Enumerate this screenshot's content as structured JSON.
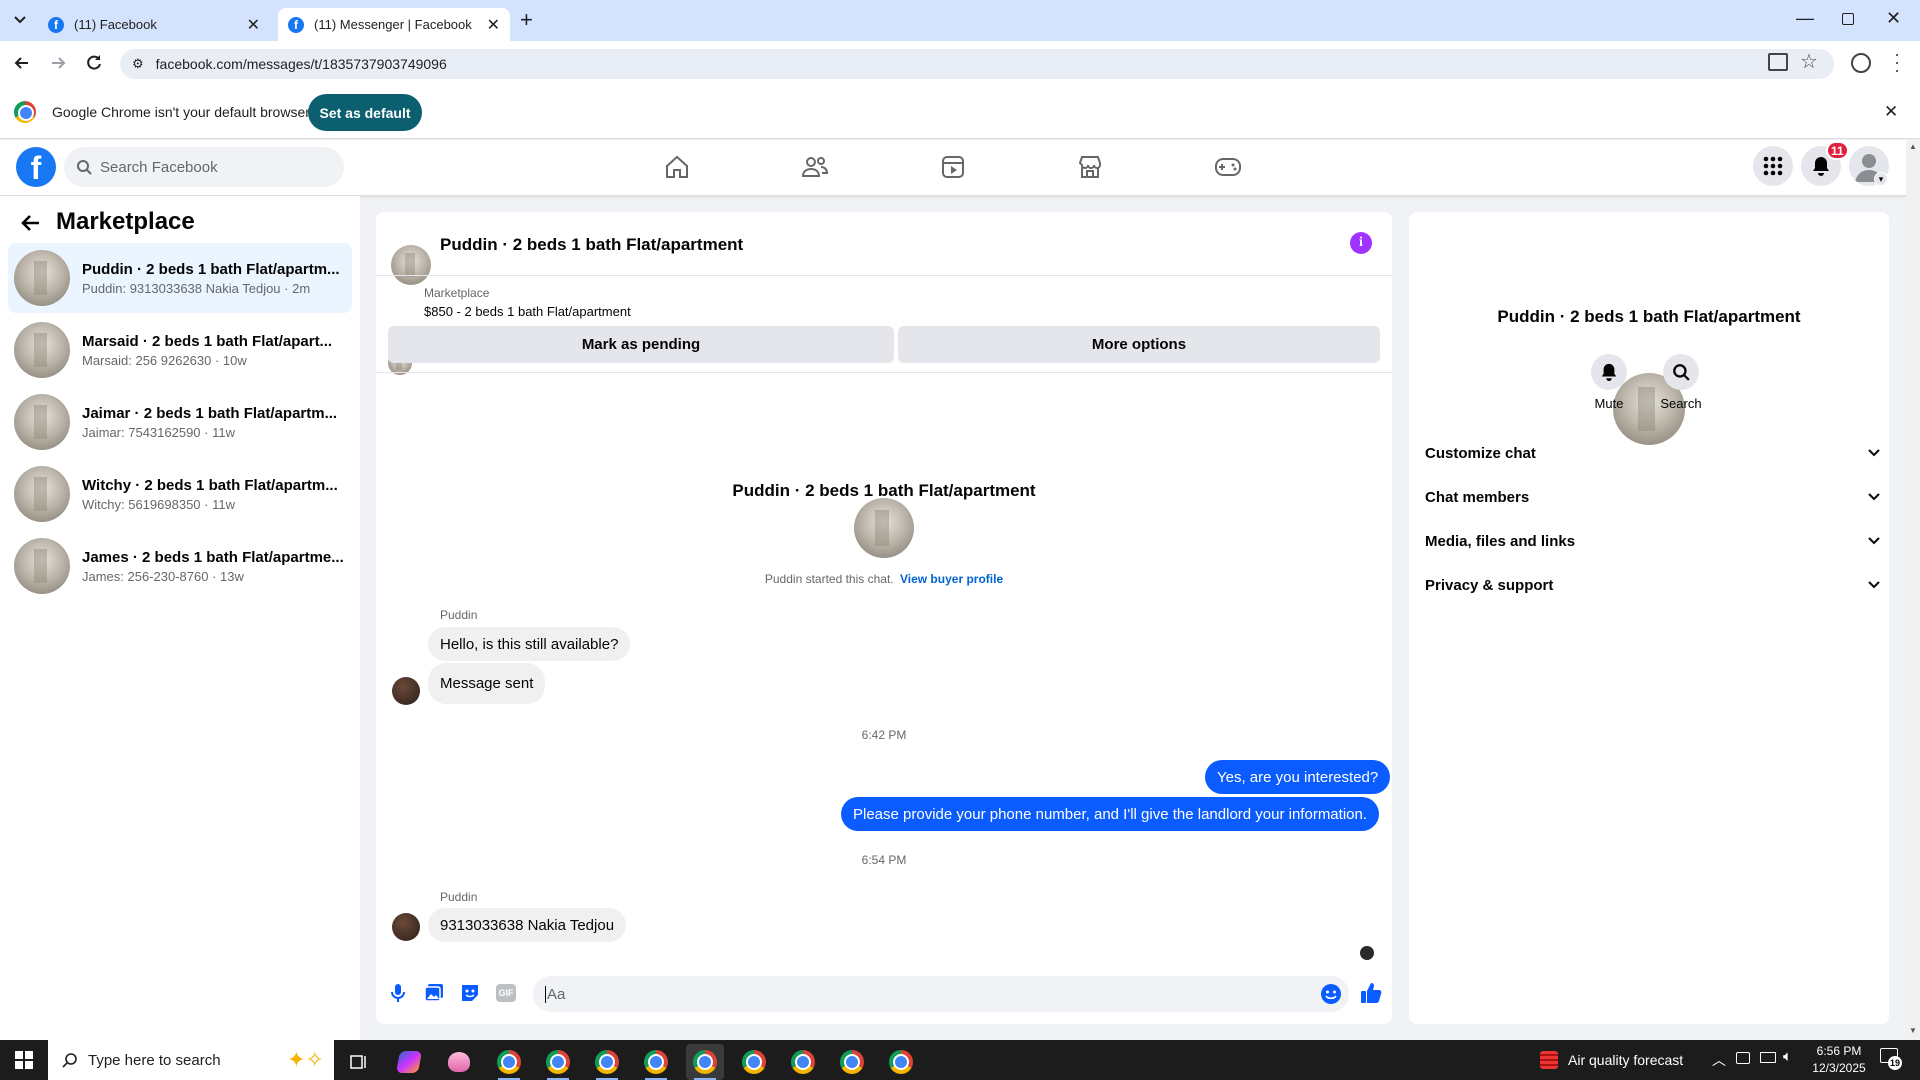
{
  "browser": {
    "tabs": [
      {
        "label": "(11) Facebook"
      },
      {
        "label": "(11) Messenger | Facebook"
      }
    ],
    "url": "facebook.com/messages/t/1835737903749096",
    "infobar": {
      "message": "Google Chrome isn't your default browser",
      "button": "Set as default"
    }
  },
  "fb": {
    "search_placeholder": "Search Facebook",
    "notifications_count": "11"
  },
  "sidebar": {
    "title": "Marketplace",
    "conversations": [
      {
        "name": "Puddin · 2 beds 1 bath Flat/apartm...",
        "snippet": "Puddin: 9313033638 Nakia Tedjou · 2m"
      },
      {
        "name": "Marsaid · 2 beds 1 bath Flat/apart...",
        "snippet": "Marsaid: 256 9262630 · 10w"
      },
      {
        "name": "Jaimar · 2 beds 1 bath Flat/apartm...",
        "snippet": "Jaimar: 7543162590 · 11w"
      },
      {
        "name": "Witchy · 2 beds 1 bath Flat/apartm...",
        "snippet": "Witchy: 5619698350 · 11w"
      },
      {
        "name": "James · 2 beds 1 bath Flat/apartme...",
        "snippet": "James: 256-230-8760 · 13w"
      }
    ]
  },
  "chat": {
    "header_title": "Puddin · 2 beds 1 bath Flat/apartment",
    "listing_source": "Marketplace",
    "listing_title": "$850 - 2 beds 1 bath Flat/apartment",
    "mark_pending": "Mark as pending",
    "more_options": "More options",
    "intro_title": "Puddin · 2 beds 1 bath Flat/apartment",
    "started_text": "Puddin started this chat.",
    "view_buyer": "View buyer profile",
    "sender_name_1": "Puddin",
    "msg_1": "Hello, is this still available?",
    "msg_2": "Message sent",
    "time_1": "6:42 PM",
    "reply_1": "Yes, are you interested?",
    "reply_2": "Please provide your phone number, and I'll give the landlord your information.",
    "time_2": "6:54 PM",
    "sender_name_2": "Puddin",
    "msg_3": "9313033638 Nakia Tedjou",
    "composer_placeholder": "Aa"
  },
  "details": {
    "title": "Puddin · 2 beds 1 bath Flat/apartment",
    "mute": "Mute",
    "search": "Search",
    "sections": [
      "Customize chat",
      "Chat members",
      "Media, files and links",
      "Privacy & support"
    ]
  },
  "taskbar": {
    "search_placeholder": "Type here to search",
    "weather": "Air quality forecast",
    "time": "6:56 PM",
    "date": "12/3/2025",
    "notif_count": "19"
  },
  "colors": {
    "fb_blue": "#1877f2",
    "messenger_blue": "#0b5cff",
    "badge_red": "#e41e3f",
    "info_purple": "#a033ff"
  }
}
